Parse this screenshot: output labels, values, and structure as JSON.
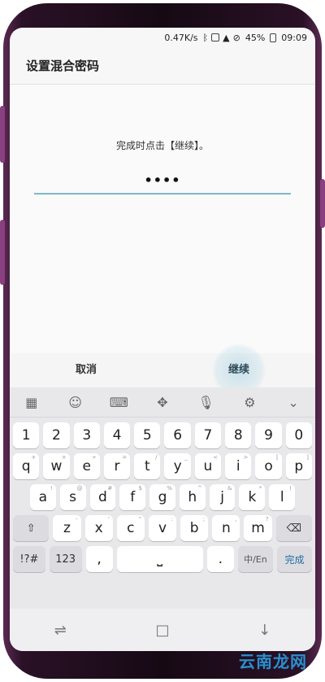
{
  "status_bar": {
    "speed": "0.47K/s",
    "battery": "45%",
    "time": "09:09"
  },
  "header": {
    "title": "设置混合密码"
  },
  "content": {
    "instruction": "完成时点击【继续】。",
    "password_mask": "••••"
  },
  "actions": {
    "cancel_label": "取消",
    "continue_label": "继续"
  },
  "keyboard": {
    "toolbar": [
      {
        "name": "apps-icon",
        "glyph": "▦"
      },
      {
        "name": "emoji-icon",
        "glyph": "☺"
      },
      {
        "name": "keyboard-icon",
        "glyph": "⌨"
      },
      {
        "name": "move-icon",
        "glyph": "✥"
      },
      {
        "name": "mic-icon",
        "glyph": "🎙"
      },
      {
        "name": "gear-icon",
        "glyph": "⚙"
      },
      {
        "name": "chevron-down-icon",
        "glyph": "⌄"
      }
    ],
    "row_numbers": [
      "1",
      "2",
      "3",
      "4",
      "5",
      "6",
      "7",
      "8",
      "9",
      "0"
    ],
    "row_q": [
      {
        "k": "q",
        "s": "+"
      },
      {
        "k": "w",
        "s": "×"
      },
      {
        "k": "e",
        "s": "÷"
      },
      {
        "k": "r",
        "s": "="
      },
      {
        "k": "t",
        "s": "/"
      },
      {
        "k": "y",
        "s": "_"
      },
      {
        "k": "u",
        "s": "<"
      },
      {
        "k": "i",
        "s": ">"
      },
      {
        "k": "o",
        "s": "["
      },
      {
        "k": "p",
        "s": "]"
      }
    ],
    "row_a": [
      {
        "k": "a",
        "s": "!"
      },
      {
        "k": "s",
        "s": "@"
      },
      {
        "k": "d",
        "s": "#"
      },
      {
        "k": "f",
        "s": "$"
      },
      {
        "k": "g",
        "s": "%"
      },
      {
        "k": "h",
        "s": "^"
      },
      {
        "k": "j",
        "s": "&"
      },
      {
        "k": "k",
        "s": "*"
      },
      {
        "k": "l",
        "s": "("
      }
    ],
    "row_z": [
      {
        "k": "z",
        "s": "-"
      },
      {
        "k": "x",
        "s": "'"
      },
      {
        "k": "c",
        "s": "\""
      },
      {
        "k": "v",
        "s": ":"
      },
      {
        "k": "b",
        "s": ";"
      },
      {
        "k": "n",
        "s": ","
      },
      {
        "k": "m",
        "s": "?"
      }
    ],
    "shift_glyph": "⇧",
    "backspace_glyph": "⌫",
    "symbols_label": "!?#",
    "numbers_label": "123",
    "comma_label": ",",
    "space_glyph": "⎵",
    "period_label": ".",
    "lang_label": "中/En",
    "done_label": "完成"
  },
  "nav": {
    "recent_glyph": "⇌",
    "home_glyph": "□",
    "back_glyph": "↓"
  },
  "watermark": "云南龙网"
}
